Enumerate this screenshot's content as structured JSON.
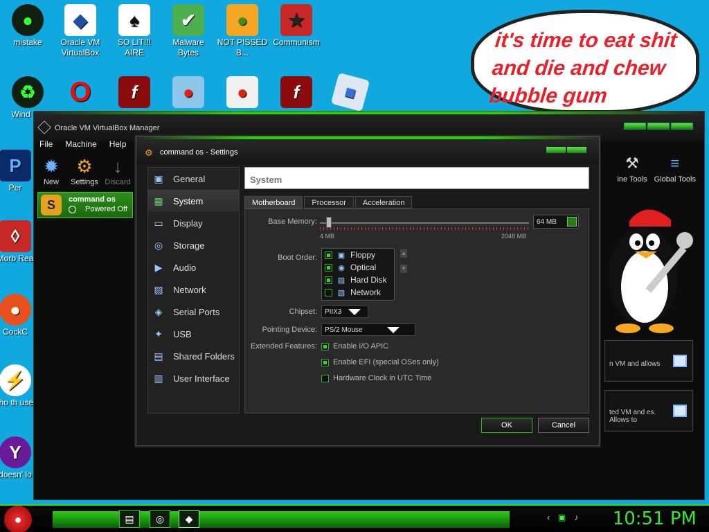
{
  "desktop": {
    "icons": [
      {
        "label": "mistake",
        "glyph": "●",
        "icon": "mistake-icon"
      },
      {
        "label": "Oracle VM VirtualBox",
        "glyph": "◆",
        "icon": "virtualbox-icon"
      },
      {
        "label": "SO LIT!!! AIRE",
        "glyph": "♠",
        "icon": "card-icon"
      },
      {
        "label": "Malware Bytes",
        "glyph": "✔",
        "icon": "shield-icon"
      },
      {
        "label": "NOT PISSED B...",
        "glyph": "●",
        "icon": "angry-birds-pig-icon"
      },
      {
        "label": "Communism",
        "glyph": "★",
        "icon": "communism-icon"
      }
    ],
    "row2": [
      {
        "label": "Wind Vis",
        "glyph": "♻",
        "icon": "recycle-bin-icon"
      },
      {
        "label": "",
        "glyph": "O",
        "icon": "opera-icon"
      },
      {
        "label": "",
        "glyph": "f",
        "icon": "flash-icon"
      },
      {
        "label": "",
        "glyph": "●",
        "icon": "angry-birds-icon"
      },
      {
        "label": "",
        "glyph": "●",
        "icon": "angry-birds-icon"
      },
      {
        "label": "",
        "glyph": "f",
        "icon": "flash-icon"
      },
      {
        "label": "",
        "glyph": "■",
        "icon": "roblox-icon"
      }
    ],
    "left": [
      {
        "label": "Per",
        "glyph": "P",
        "icon": "photoshop-icon"
      },
      {
        "label": "Morb Rea",
        "glyph": "◊",
        "icon": "pdf-reader-icon"
      },
      {
        "label": "CockC",
        "glyph": "●",
        "icon": "cockc-icon"
      },
      {
        "label": "who th uses",
        "glyph": "⚡",
        "icon": "who-uses-icon"
      },
      {
        "label": "doesn' lo",
        "glyph": "Y",
        "icon": "yahoo-icon"
      }
    ],
    "bubble_text": "it's time to eat shit and die and chew bubble gum"
  },
  "manager": {
    "title": "Oracle VM VirtualBox Manager",
    "menu": [
      "File",
      "Machine",
      "Help"
    ],
    "tools": [
      {
        "label": "New",
        "glyph": "✹",
        "icon": "new-icon"
      },
      {
        "label": "Settings",
        "glyph": "⚙",
        "icon": "settings-gear-icon"
      },
      {
        "label": "Discard",
        "glyph": "↓",
        "icon": "discard-arrow-icon"
      }
    ],
    "vm": {
      "name": "command os",
      "state": "Powered Off",
      "glyph": "S"
    },
    "right_tools": [
      {
        "label": "ine Tools",
        "glyph": "⚒",
        "icon": "machine-tools-icon"
      },
      {
        "label": "Global Tools",
        "glyph": "≡",
        "icon": "global-tools-icon"
      }
    ],
    "cards": [
      "n VM and allows",
      "ted VM and es. Allows to"
    ]
  },
  "settings": {
    "title": "command os - Settings",
    "categories": [
      {
        "label": "General",
        "glyph": "▣",
        "icon": "general-icon"
      },
      {
        "label": "System",
        "glyph": "▦",
        "icon": "system-chip-icon"
      },
      {
        "label": "Display",
        "glyph": "▭",
        "icon": "display-monitor-icon"
      },
      {
        "label": "Storage",
        "glyph": "◎",
        "icon": "storage-disc-icon"
      },
      {
        "label": "Audio",
        "glyph": "▶",
        "icon": "audio-speaker-icon"
      },
      {
        "label": "Network",
        "glyph": "▧",
        "icon": "network-icon"
      },
      {
        "label": "Serial Ports",
        "glyph": "◈",
        "icon": "serial-port-icon"
      },
      {
        "label": "USB",
        "glyph": "✦",
        "icon": "usb-icon"
      },
      {
        "label": "Shared Folders",
        "glyph": "▤",
        "icon": "shared-folder-icon"
      },
      {
        "label": "User Interface",
        "glyph": "▥",
        "icon": "user-interface-icon"
      }
    ],
    "selected_category": "System",
    "section_title": "System",
    "tabs": [
      "Motherboard",
      "Processor",
      "Acceleration"
    ],
    "selected_tab": "Motherboard",
    "base_memory": {
      "label": "Base Memory:",
      "value": "64 MB",
      "min": "4 MB",
      "max": "2048 MB",
      "fraction": 0.03
    },
    "boot_order": {
      "label": "Boot Order:",
      "items": [
        {
          "label": "Floppy",
          "checked": true,
          "glyph": "▣",
          "icon": "floppy-icon"
        },
        {
          "label": "Optical",
          "checked": true,
          "glyph": "◉",
          "icon": "optical-disc-icon"
        },
        {
          "label": "Hard Disk",
          "checked": true,
          "glyph": "▨",
          "icon": "hard-disk-icon"
        },
        {
          "label": "Network",
          "checked": false,
          "glyph": "▧",
          "icon": "network-icon"
        }
      ]
    },
    "chipset": {
      "label": "Chipset:",
      "value": "PIIX3"
    },
    "pointing_device": {
      "label": "Pointing Device:",
      "value": "PS/2 Mouse"
    },
    "extended_features": {
      "label": "Extended Features:",
      "items": [
        {
          "label": "Enable I/O APIC",
          "checked": true
        },
        {
          "label": "Enable EFI (special OSes only)",
          "checked": true
        },
        {
          "label": "Hardware Clock in UTC Time",
          "checked": false
        }
      ]
    },
    "ok_label": "OK",
    "cancel_label": "Cancel"
  },
  "taskbar": {
    "time": "10:51 PM",
    "apps": [
      {
        "glyph": "▤",
        "icon": "file-explorer-icon"
      },
      {
        "glyph": "◎",
        "icon": "edge-icon"
      },
      {
        "glyph": "◆",
        "icon": "virtualbox-taskbar-icon"
      }
    ],
    "tray": [
      {
        "glyph": "‹",
        "icon": "tray-chevron-icon"
      },
      {
        "glyph": "▣",
        "icon": "network-tray-icon"
      },
      {
        "glyph": "♪",
        "icon": "volume-icon"
      }
    ]
  },
  "colors": {
    "desktop": "#11a8e0",
    "accent_green": "#2fdc18",
    "bubble_text": "#e8202a"
  }
}
